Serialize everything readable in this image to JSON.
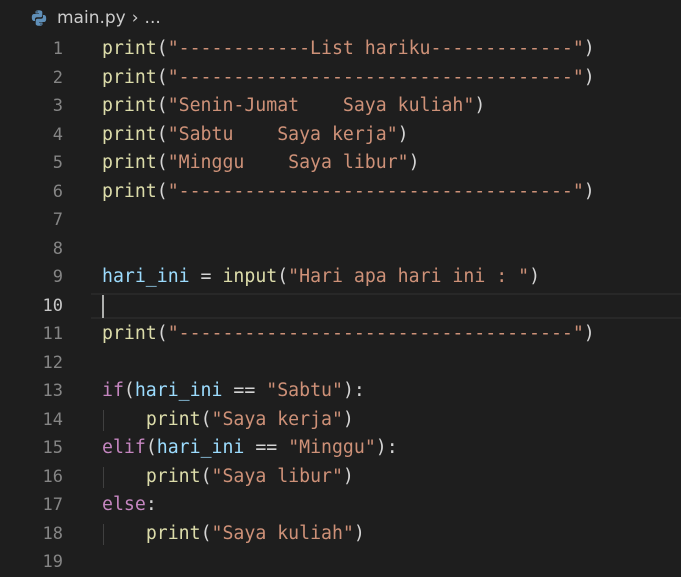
{
  "breadcrumb": {
    "file_icon": "python-icon",
    "file_name": "main.py",
    "chevron": "›",
    "ellipsis": "..."
  },
  "active_line": 10,
  "lines": [
    {
      "num": "1",
      "tokens": [
        {
          "t": "print",
          "c": "fn"
        },
        {
          "t": "(",
          "c": "pun"
        },
        {
          "t": "\"------------List hariku-------------\"",
          "c": "str"
        },
        {
          "t": ")",
          "c": "pun"
        }
      ]
    },
    {
      "num": "2",
      "tokens": [
        {
          "t": "print",
          "c": "fn"
        },
        {
          "t": "(",
          "c": "pun"
        },
        {
          "t": "\"------------------------------------\"",
          "c": "str"
        },
        {
          "t": ")",
          "c": "pun"
        }
      ]
    },
    {
      "num": "3",
      "tokens": [
        {
          "t": "print",
          "c": "fn"
        },
        {
          "t": "(",
          "c": "pun"
        },
        {
          "t": "\"Senin-Jumat    Saya kuliah\"",
          "c": "str"
        },
        {
          "t": ")",
          "c": "pun"
        }
      ]
    },
    {
      "num": "4",
      "tokens": [
        {
          "t": "print",
          "c": "fn"
        },
        {
          "t": "(",
          "c": "pun"
        },
        {
          "t": "\"Sabtu    Saya kerja\"",
          "c": "str"
        },
        {
          "t": ")",
          "c": "pun"
        }
      ]
    },
    {
      "num": "5",
      "tokens": [
        {
          "t": "print",
          "c": "fn"
        },
        {
          "t": "(",
          "c": "pun"
        },
        {
          "t": "\"Minggu    Saya libur\"",
          "c": "str"
        },
        {
          "t": ")",
          "c": "pun"
        }
      ]
    },
    {
      "num": "6",
      "tokens": [
        {
          "t": "print",
          "c": "fn"
        },
        {
          "t": "(",
          "c": "pun"
        },
        {
          "t": "\"------------------------------------\"",
          "c": "str"
        },
        {
          "t": ")",
          "c": "pun"
        }
      ]
    },
    {
      "num": "7",
      "tokens": []
    },
    {
      "num": "8",
      "tokens": []
    },
    {
      "num": "9",
      "tokens": [
        {
          "t": "hari_ini",
          "c": "var"
        },
        {
          "t": " = ",
          "c": "pun"
        },
        {
          "t": "input",
          "c": "fn"
        },
        {
          "t": "(",
          "c": "pun"
        },
        {
          "t": "\"Hari apa hari ini : \"",
          "c": "str"
        },
        {
          "t": ")",
          "c": "pun"
        }
      ]
    },
    {
      "num": "10",
      "tokens": []
    },
    {
      "num": "11",
      "tokens": [
        {
          "t": "print",
          "c": "fn"
        },
        {
          "t": "(",
          "c": "pun"
        },
        {
          "t": "\"------------------------------------\"",
          "c": "str"
        },
        {
          "t": ")",
          "c": "pun"
        }
      ]
    },
    {
      "num": "12",
      "tokens": []
    },
    {
      "num": "13",
      "tokens": [
        {
          "t": "if",
          "c": "kw"
        },
        {
          "t": "(",
          "c": "pun"
        },
        {
          "t": "hari_ini",
          "c": "var"
        },
        {
          "t": " == ",
          "c": "pun"
        },
        {
          "t": "\"Sabtu\"",
          "c": "str"
        },
        {
          "t": "):",
          "c": "pun"
        }
      ]
    },
    {
      "num": "14",
      "indent": true,
      "tokens": [
        {
          "t": "    ",
          "c": "pun"
        },
        {
          "t": "print",
          "c": "fn"
        },
        {
          "t": "(",
          "c": "pun"
        },
        {
          "t": "\"Saya kerja\"",
          "c": "str"
        },
        {
          "t": ")",
          "c": "pun"
        }
      ]
    },
    {
      "num": "15",
      "tokens": [
        {
          "t": "elif",
          "c": "kw"
        },
        {
          "t": "(",
          "c": "pun"
        },
        {
          "t": "hari_ini",
          "c": "var"
        },
        {
          "t": " == ",
          "c": "pun"
        },
        {
          "t": "\"Minggu\"",
          "c": "str"
        },
        {
          "t": "):",
          "c": "pun"
        }
      ]
    },
    {
      "num": "16",
      "indent": true,
      "tokens": [
        {
          "t": "    ",
          "c": "pun"
        },
        {
          "t": "print",
          "c": "fn"
        },
        {
          "t": "(",
          "c": "pun"
        },
        {
          "t": "\"Saya libur\"",
          "c": "str"
        },
        {
          "t": ")",
          "c": "pun"
        }
      ]
    },
    {
      "num": "17",
      "tokens": [
        {
          "t": "else",
          "c": "kw"
        },
        {
          "t": ":",
          "c": "pun"
        }
      ]
    },
    {
      "num": "18",
      "indent": true,
      "tokens": [
        {
          "t": "    ",
          "c": "pun"
        },
        {
          "t": "print",
          "c": "fn"
        },
        {
          "t": "(",
          "c": "pun"
        },
        {
          "t": "\"Saya kuliah\"",
          "c": "str"
        },
        {
          "t": ")",
          "c": "pun"
        }
      ]
    },
    {
      "num": "19",
      "tokens": []
    }
  ]
}
